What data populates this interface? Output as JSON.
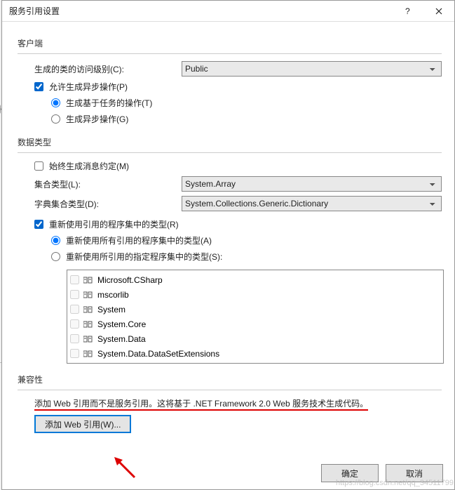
{
  "dialog": {
    "title": "服务引用设置"
  },
  "client": {
    "group_label": "客户端",
    "access_level_label": "生成的类的访问级别(C):",
    "access_level_value": "Public",
    "allow_async_label": "允许生成异步操作(P)",
    "async_task_label": "生成基于任务的操作(T)",
    "async_op_label": "生成异步操作(G)"
  },
  "datatype": {
    "group_label": "数据类型",
    "always_message_contract_label": "始终生成消息约定(M)",
    "collection_type_label": "集合类型(L):",
    "collection_type_value": "System.Array",
    "dictionary_type_label": "字典集合类型(D):",
    "dictionary_type_value": "System.Collections.Generic.Dictionary",
    "reuse_types_label": "重新使用引用的程序集中的类型(R)",
    "reuse_all_label": "重新使用所有引用的程序集中的类型(A)",
    "reuse_specified_label": "重新使用所引用的指定程序集中的类型(S):",
    "assemblies": [
      "Microsoft.CSharp",
      "mscorlib",
      "System",
      "System.Core",
      "System.Data",
      "System.Data.DataSetExtensions"
    ]
  },
  "compat": {
    "group_label": "兼容性",
    "text_part1": "添加 Web 引用而不是服务引用。这将基于 ",
    "text_part2": ".NET Framework 2.0 Web 服务技术生成代码。",
    "add_web_ref_label": "添加 Web 引用(W)..."
  },
  "footer": {
    "ok_label": "确定",
    "cancel_label": "取消"
  },
  "watermark": "https://blog.csdn.net/qq_34511799"
}
